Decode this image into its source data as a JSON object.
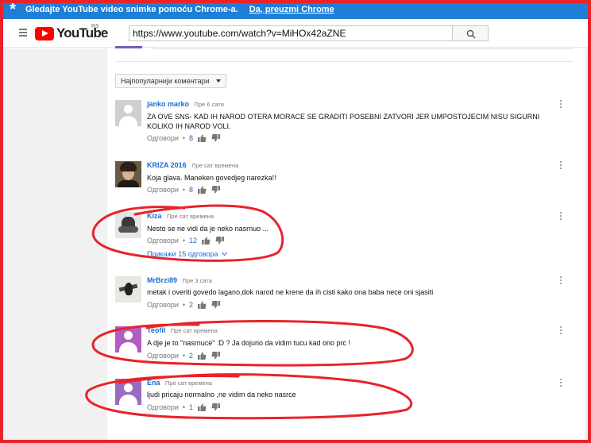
{
  "promo": {
    "star": "*",
    "message": "Gledajte YouTube video snimke pomoću Chrome-a.",
    "link": "Da, preuzmi Chrome"
  },
  "masthead": {
    "logo_word": "YouTube",
    "region": "RS",
    "url": "https://www.youtube.com/watch?v=MiHOx42aZNE"
  },
  "sort": {
    "label": "Најпопуларнији коментари"
  },
  "labels": {
    "reply": "Одговори",
    "dot": "•"
  },
  "comments": [
    {
      "author": "janko marko",
      "time": "Пре 6 сати",
      "text": "ZA OVE SNS- KAD IH NAROD OTERA MORACE SE GRADITI POSEBNI ZATVORI JER UMPOSTOJECIM NISU SIGURNI KOLIKO IH NAROD VOLI.",
      "likes": "8",
      "avatar": "default-gray"
    },
    {
      "author": "KRIZA 2016",
      "time": "Пре сат времена",
      "text": "Koja glava. Maneken govedjeg narezka!!",
      "likes": "8",
      "avatar": "photo"
    },
    {
      "author": "Kiza",
      "time": "Пре сат времена",
      "text": "Nesto se ne vidi da je neko nasrnuo ...",
      "likes": "12",
      "avatar": "bw-photo",
      "replies": "Прикажи 15 одговора"
    },
    {
      "author": "MrBrzi89",
      "time": "Пре 3 сата",
      "text": "metak i overiti govedo lagano,dok narod ne krene da ih cisti kako ona baba  nece oni sjasiti",
      "likes": "2",
      "avatar": "bird"
    },
    {
      "author": "Teofil",
      "time": "Пре сат времена",
      "text": "A dje je to \"nasrnuce\" :D ? Ja dojurio da vidim tucu kad ono prc !",
      "likes": "2",
      "avatar": "default-purple"
    },
    {
      "author": "Ena",
      "time": "Пре сат времена",
      "text": "ljudi pricaju normalno ,ne vidim da neko nasrce",
      "likes": "1",
      "avatar": "default-purple"
    }
  ],
  "colors": {
    "promo_bg": "#1e7fd6",
    "author_link": "#1a6cd1",
    "annotation_red": "#e8232a",
    "youtube_red": "#ff0000"
  }
}
